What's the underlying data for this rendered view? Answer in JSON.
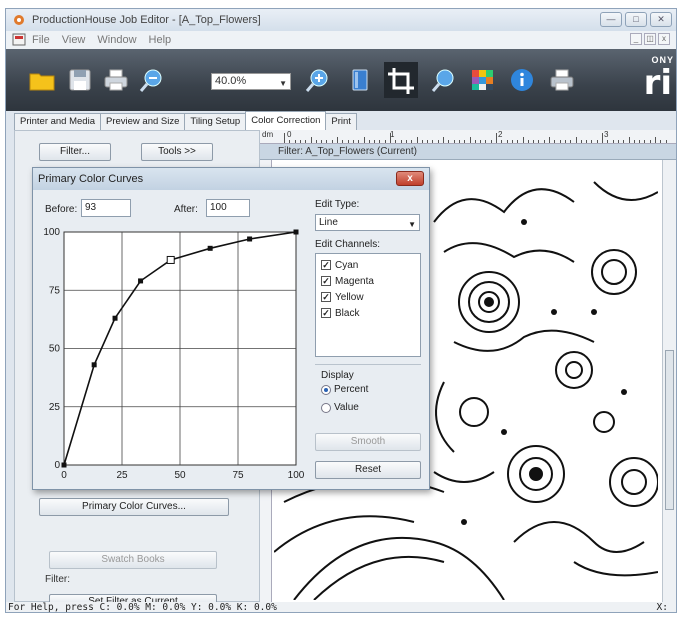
{
  "window": {
    "title": "ProductionHouse Job Editor - [A_Top_Flowers]",
    "controls": [
      "—",
      "□",
      "✕"
    ]
  },
  "menu": {
    "items": [
      "File",
      "View",
      "Window",
      "Help"
    ],
    "mdi_controls": [
      "_",
      "◫",
      "x"
    ]
  },
  "toolbar": {
    "zoom_value": "40.0%",
    "brand_small": "ONY",
    "brand_big": "ri"
  },
  "tabs": [
    "Printer and Media",
    "Preview and Size",
    "Tiling Setup",
    "Color Correction",
    "Print"
  ],
  "left_panel": {
    "filter_button": "Filter...",
    "tools_button": "Tools >>",
    "primary_curves_button": "Primary Color Curves...",
    "swatch_books_button": "Swatch Books",
    "filter_label": "Filter:",
    "set_filter_button": "Set Filter as Current"
  },
  "right_panel": {
    "ruler_unit": "dm",
    "ruler_numbers": [
      "0",
      "1",
      "2",
      "3"
    ],
    "filter_title": "Filter: A_Top_Flowers (Current)"
  },
  "dialog": {
    "title": "Primary Color Curves",
    "close_label": "x",
    "before_label": "Before:",
    "before_value": "93",
    "after_label": "After:",
    "after_value": "100",
    "edit_type_label": "Edit Type:",
    "edit_type_value": "Line",
    "edit_channels_label": "Edit Channels:",
    "channels": [
      {
        "name": "Cyan",
        "checked": true
      },
      {
        "name": "Magenta",
        "checked": true
      },
      {
        "name": "Yellow",
        "checked": true
      },
      {
        "name": "Black",
        "checked": true
      }
    ],
    "display_label": "Display",
    "display_options": [
      {
        "label": "Percent",
        "selected": true
      },
      {
        "label": "Value",
        "selected": false
      }
    ],
    "smooth_button": "Smooth",
    "reset_button": "Reset"
  },
  "chart_data": {
    "type": "line",
    "title": "",
    "xlabel": "",
    "ylabel": "",
    "xlim": [
      0,
      100
    ],
    "ylim": [
      0,
      100
    ],
    "x_ticks": [
      "0",
      "25",
      "50",
      "75",
      "100"
    ],
    "y_ticks": [
      "0",
      "25",
      "50",
      "75",
      "100"
    ],
    "grid": true,
    "series": [
      {
        "points": [
          [
            0,
            0
          ],
          [
            13,
            43
          ],
          [
            22,
            63
          ],
          [
            33,
            79
          ],
          [
            46,
            88
          ],
          [
            63,
            93
          ],
          [
            80,
            97
          ],
          [
            100,
            100
          ]
        ],
        "selected_point": [
          46,
          88
        ]
      }
    ]
  },
  "status": {
    "left": "For Help, press C:  0.0% M:  0.0% Y:  0.0% K:  0.0%",
    "right": "X:"
  }
}
